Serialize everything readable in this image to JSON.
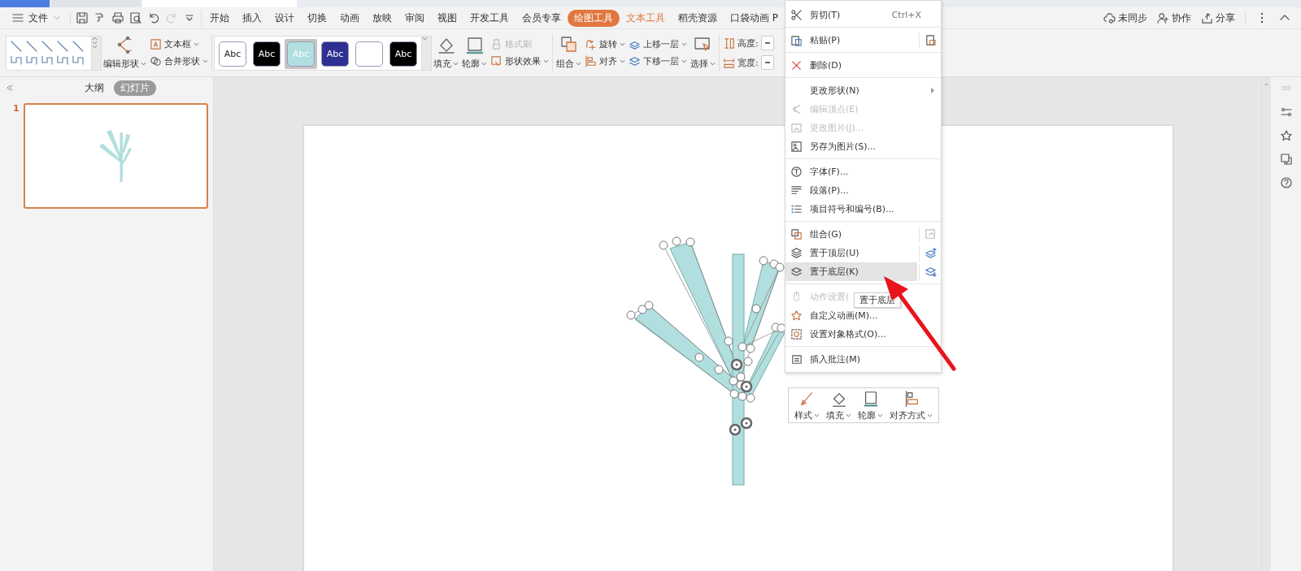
{
  "menu_bar": {
    "file_menu": "文件",
    "tabs": [
      {
        "label": "开始",
        "kind": "plain",
        "selected": false
      },
      {
        "label": "插入",
        "kind": "plain",
        "selected": false
      },
      {
        "label": "设计",
        "kind": "plain",
        "selected": false
      },
      {
        "label": "切换",
        "kind": "plain",
        "selected": false
      },
      {
        "label": "动画",
        "kind": "plain",
        "selected": false
      },
      {
        "label": "放映",
        "kind": "plain",
        "selected": false
      },
      {
        "label": "审阅",
        "kind": "plain",
        "selected": false
      },
      {
        "label": "视图",
        "kind": "plain",
        "selected": false
      },
      {
        "label": "开发工具",
        "kind": "plain",
        "selected": false
      },
      {
        "label": "会员专享",
        "kind": "plain",
        "selected": false
      },
      {
        "label": "绘图工具",
        "kind": "context",
        "selected": true
      },
      {
        "label": "文本工具",
        "kind": "context",
        "selected": false
      },
      {
        "label": "稻壳资源",
        "kind": "plain",
        "selected": false
      },
      {
        "label": "口袋动画 P",
        "kind": "plain",
        "selected": false
      }
    ],
    "actions": [
      {
        "label": "未同步",
        "kind": "sync"
      },
      {
        "label": "协作",
        "kind": "collab"
      },
      {
        "label": "分享",
        "kind": "share"
      }
    ]
  },
  "ribbon": {
    "edit_shape": {
      "label": "编辑形状",
      "dropdown": true
    },
    "text_box": {
      "label": "文本框",
      "dropdown": true
    },
    "merge_shapes": {
      "label": "合并形状",
      "dropdown": true
    },
    "style_swatches": [
      {
        "text": "Abc",
        "color": "#ffffff",
        "selected": false
      },
      {
        "text": "Abc",
        "color": "#000000",
        "selected": false
      },
      {
        "text": "Abc",
        "color": "#b1dfe0",
        "selected": true
      },
      {
        "text": "Abc",
        "color": "#2e3192",
        "selected": false
      },
      {
        "color": "#ffffff",
        "selected": false
      },
      {
        "text": "Abc",
        "color": "#000000",
        "selected": false
      }
    ],
    "fill": {
      "label": "填充",
      "dropdown": true
    },
    "outline": {
      "label": "轮廓",
      "dropdown": true
    },
    "format_painter": {
      "label": "格式刷",
      "disabled": true
    },
    "shape_effects": {
      "label": "形状效果",
      "dropdown": true
    },
    "group": {
      "label": "组合",
      "dropdown": true
    },
    "rotate": {
      "label": "旋转",
      "dropdown": true
    },
    "align": {
      "label": "对齐",
      "dropdown": true
    },
    "bring_forward": {
      "label": "上移一层",
      "dropdown": true
    },
    "send_backward": {
      "label": "下移一层",
      "dropdown": true
    },
    "select": {
      "label": "选择",
      "dropdown": true
    },
    "height": {
      "label": "高度:"
    },
    "width": {
      "label": "宽度:"
    }
  },
  "left_panel": {
    "tabs": [
      {
        "label": "大纲",
        "selected": false
      },
      {
        "label": "幻灯片",
        "selected": true
      }
    ],
    "slides": [
      {
        "number": "1",
        "selected": true
      }
    ]
  },
  "context_menu": {
    "groups": [
      [
        {
          "label": "剪切(T)",
          "shortcut": "Ctrl+X",
          "disabled": false,
          "selected": false,
          "submenu": false,
          "side_action": false
        }
      ],
      [
        {
          "label": "粘贴(P)",
          "disabled": false,
          "selected": false,
          "submenu": false,
          "side_action": true
        }
      ],
      [
        {
          "label": "删除(D)",
          "disabled": false,
          "selected": false,
          "submenu": false,
          "side_action": false
        }
      ],
      [
        {
          "label": "更改形状(N)",
          "disabled": false,
          "selected": false,
          "submenu": true,
          "side_action": false
        },
        {
          "label": "编辑顶点(E)",
          "disabled": true,
          "selected": false,
          "submenu": false,
          "side_action": false
        },
        {
          "label": "更改图片(J)...",
          "disabled": true,
          "selected": false,
          "submenu": false,
          "side_action": false
        },
        {
          "label": "另存为图片(S)...",
          "disabled": false,
          "selected": false,
          "submenu": false,
          "side_action": false
        }
      ],
      [
        {
          "label": "字体(F)...",
          "disabled": false,
          "selected": false,
          "submenu": false,
          "side_action": false
        },
        {
          "label": "段落(P)...",
          "disabled": false,
          "selected": false,
          "submenu": false,
          "side_action": false
        },
        {
          "label": "项目符号和编号(B)...",
          "disabled": false,
          "selected": false,
          "submenu": false,
          "side_action": false
        }
      ],
      [
        {
          "label": "组合(G)",
          "disabled": false,
          "selected": false,
          "submenu": false,
          "side_action": true
        },
        {
          "label": "置于顶层(U)",
          "disabled": false,
          "selected": false,
          "submenu": false,
          "side_action": true
        },
        {
          "label": "置于底层(K)",
          "disabled": false,
          "selected": true,
          "submenu": false,
          "side_action": true
        }
      ],
      [
        {
          "label": "动作设置(",
          "disabled": true,
          "selected": false,
          "submenu": false,
          "side_action": false
        },
        {
          "label": "自定义动画(M)...",
          "disabled": false,
          "selected": false,
          "submenu": false,
          "side_action": false
        },
        {
          "label": "设置对象格式(O)...",
          "disabled": false,
          "selected": false,
          "submenu": false,
          "side_action": false
        }
      ],
      [
        {
          "label": "插入批注(M)",
          "disabled": false,
          "selected": false,
          "submenu": false,
          "side_action": false
        }
      ]
    ],
    "tooltip": "置于底层"
  },
  "floating_toolbar": [
    {
      "label": "样式",
      "dropdown": true
    },
    {
      "label": "填充",
      "dropdown": true
    },
    {
      "label": "轮廓",
      "dropdown": true
    },
    {
      "label": "对齐方式",
      "dropdown": true
    }
  ]
}
